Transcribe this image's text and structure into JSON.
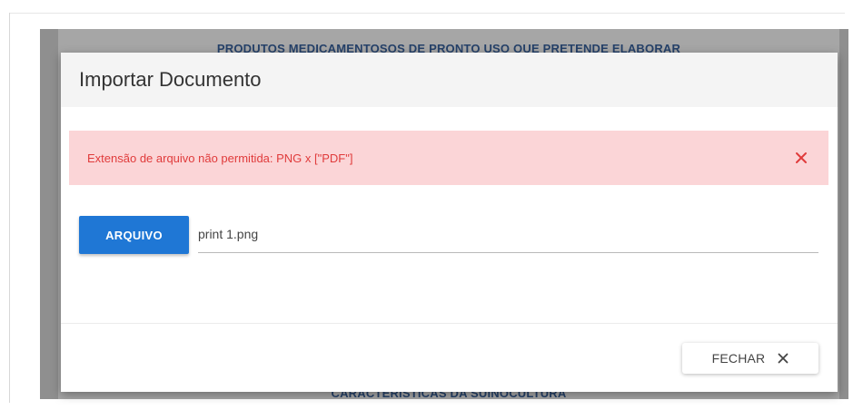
{
  "background": {
    "top_heading": "PRODUTOS MEDICAMENTOSOS DE PRONTO USO QUE PRETENDE ELABORAR",
    "bottom_heading": "CARACTERÍSTICAS DA SUINOCULTURA"
  },
  "modal": {
    "title": "Importar Documento",
    "alert": {
      "message": "Extensão de arquivo não permitida: PNG x [\"PDF\"]",
      "close_icon": "close-icon",
      "color": "#e03b3b",
      "background": "#fbd5d7"
    },
    "file_button_label": "ARQUIVO",
    "file_name": "print 1.png",
    "close_button_label": "FECHAR",
    "close_button_icon": "close-icon",
    "accent_color": "#1f77d5"
  }
}
